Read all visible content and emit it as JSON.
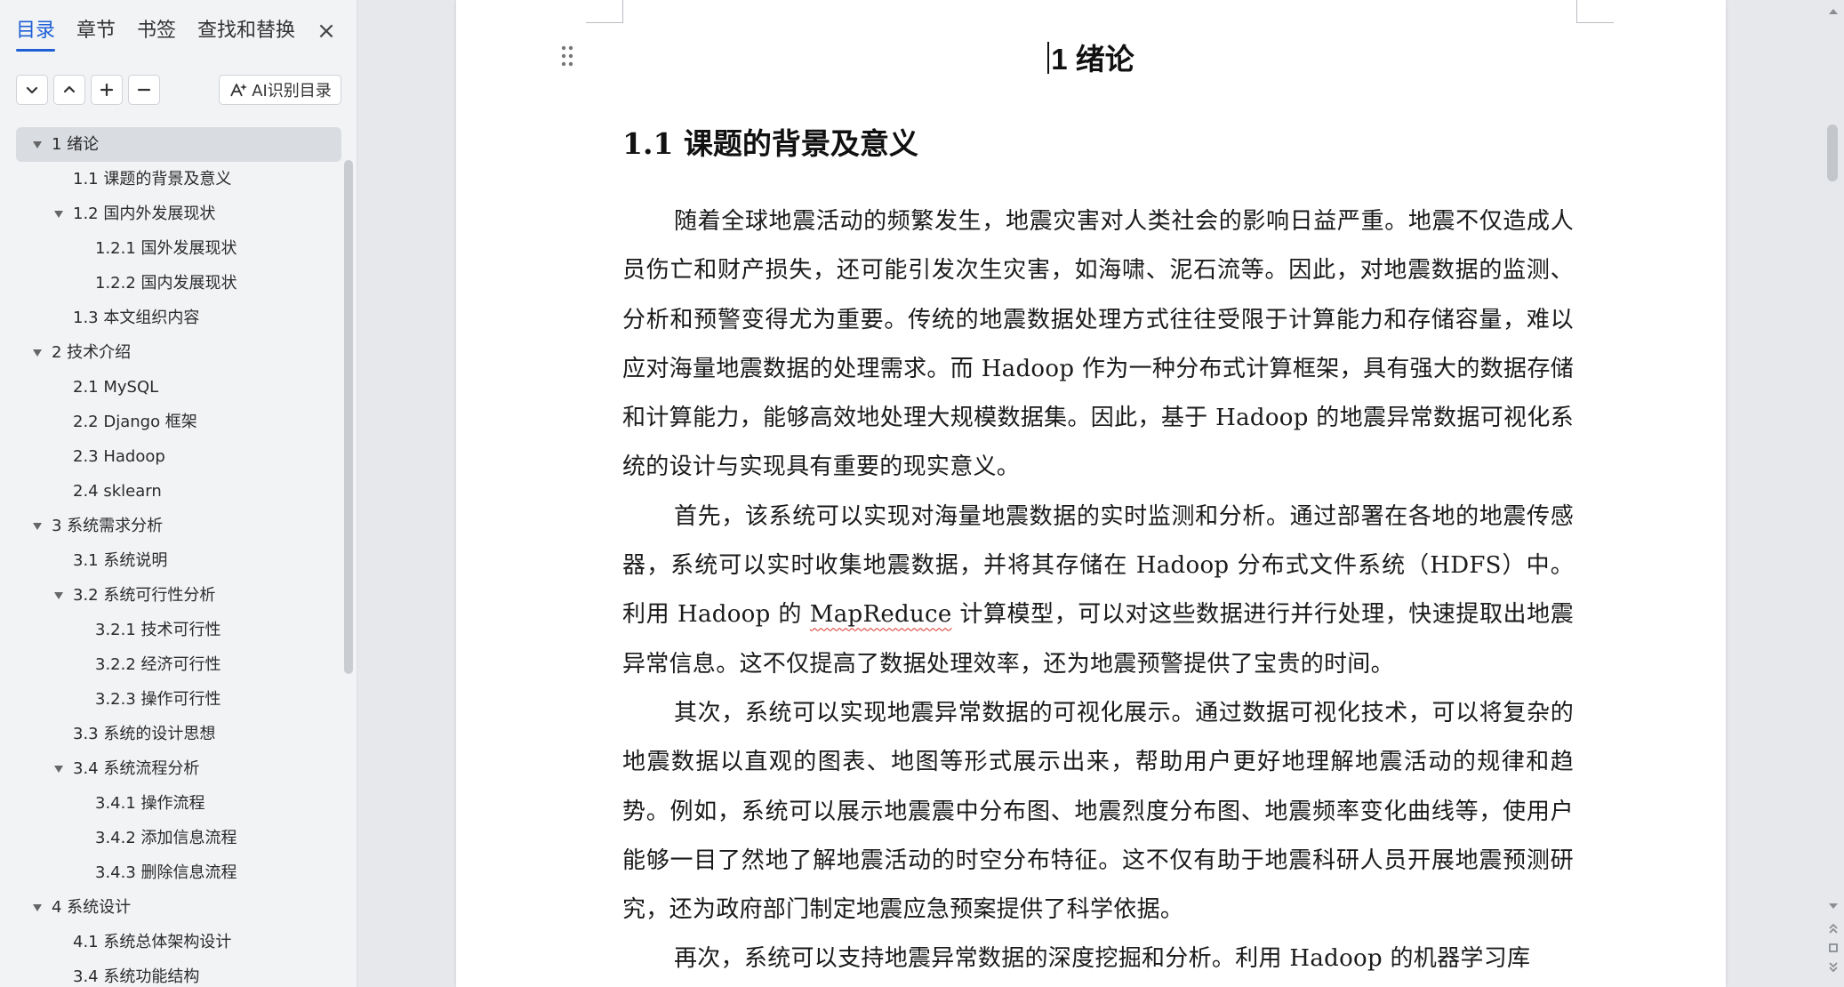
{
  "sidebar": {
    "tabs": [
      "目录",
      "章节",
      "书签",
      "查找和替换"
    ],
    "close_symbol": "×",
    "toolbar_icons": [
      "chevron-down-icon",
      "chevron-up-icon",
      "plus-icon",
      "minus-icon"
    ],
    "ai_button_label": "AI识别目录",
    "toc": [
      {
        "label": "1  绪论",
        "level": 1,
        "expanded": true,
        "selected": true
      },
      {
        "label": "1.1  课题的背景及意义",
        "level": 2,
        "expanded": null
      },
      {
        "label": "1.2  国内外发展现状",
        "level": 2,
        "expanded": true
      },
      {
        "label": "1.2.1  国外发展现状",
        "level": 3,
        "expanded": null
      },
      {
        "label": "1.2.2  国内发展现状",
        "level": 3,
        "expanded": null
      },
      {
        "label": "1.3  本文组织内容",
        "level": 2,
        "expanded": null
      },
      {
        "label": "2  技术介绍",
        "level": 1,
        "expanded": true
      },
      {
        "label": "2.1 MySQL",
        "level": 2,
        "expanded": null
      },
      {
        "label": "2.2 Django 框架",
        "level": 2,
        "expanded": null
      },
      {
        "label": "2.3 Hadoop",
        "level": 2,
        "expanded": null
      },
      {
        "label": "2.4 sklearn",
        "level": 2,
        "expanded": null
      },
      {
        "label": "3 系统需求分析",
        "level": 1,
        "expanded": true
      },
      {
        "label": "3.1 系统说明",
        "level": 2,
        "expanded": null
      },
      {
        "label": "3.2 系统可行性分析",
        "level": 2,
        "expanded": true
      },
      {
        "label": "3.2.1 技术可行性",
        "level": 3,
        "expanded": null
      },
      {
        "label": "3.2.2 经济可行性",
        "level": 3,
        "expanded": null
      },
      {
        "label": "3.2.3 操作可行性",
        "level": 3,
        "expanded": null
      },
      {
        "label": "3.3 系统的设计思想",
        "level": 2,
        "expanded": null
      },
      {
        "label": "3.4 系统流程分析",
        "level": 2,
        "expanded": true
      },
      {
        "label": "3.4.1 操作流程",
        "level": 3,
        "expanded": null
      },
      {
        "label": "3.4.2 添加信息流程",
        "level": 3,
        "expanded": null
      },
      {
        "label": "3.4.3 删除信息流程",
        "level": 3,
        "expanded": null
      },
      {
        "label": "4 系统设计",
        "level": 1,
        "expanded": true
      },
      {
        "label": "4.1  系统总体架构设计",
        "level": 2,
        "expanded": null
      },
      {
        "label": "3.4 系统功能结构",
        "level": 2,
        "expanded": null
      }
    ]
  },
  "document": {
    "chapter_title": "1  绪论",
    "section_title": "1.1  课题的背景及意义",
    "paragraphs": [
      {
        "before": "随着全球地震活动的频繁发生，地震灾害对人类社会的影响日益严重。地震不仅造成人员伤亡和财产损失，还可能引发次生灾害，如海啸、泥石流等。因此，对地震数据的监测、分析和预警变得尤为重要。传统的地震数据处理方式往往受限于计算能力和存储容量，难以应对海量地震数据的处理需求。而 Hadoop 作为一种分布式计算框架，具有强大的数据存储和计算能力，能够高效地处理大规模数据集。因此，基于 Hadoop 的地震异常数据可视化系统的设计与实现具有重要的现实意义。",
        "marked": "",
        "after": ""
      },
      {
        "before": "首先，该系统可以实现对海量地震数据的实时监测和分析。通过部署在各地的地震传感器，系统可以实时收集地震数据，并将其存储在 Hadoop 分布式文件系统（HDFS）中。利用 Hadoop 的 ",
        "marked": "MapReduce",
        "after": " 计算模型，可以对这些数据进行并行处理，快速提取出地震异常信息。这不仅提高了数据处理效率，还为地震预警提供了宝贵的时间。"
      },
      {
        "before": "其次，系统可以实现地震异常数据的可视化展示。通过数据可视化技术，可以将复杂的地震数据以直观的图表、地图等形式展示出来，帮助用户更好地理解地震活动的规律和趋势。例如，系统可以展示地震震中分布图、地震烈度分布图、地震频率变化曲线等，使用户能够一目了然地了解地震活动的时空分布特征。这不仅有助于地震科研人员开展地震预测研究，还为政府部门制定地震应急预案提供了科学依据。",
        "marked": "",
        "after": ""
      },
      {
        "before": "再次，系统可以支持地震异常数据的深度挖掘和分析。利用 Hadoop 的机器学习库",
        "marked": "",
        "after": ""
      }
    ]
  },
  "scrollbar": {
    "nav_icons": [
      "scroll-up-arrow-icon",
      "scroll-down-arrow-icon",
      "previous-page-icon",
      "select-browse-object-icon",
      "next-page-icon"
    ]
  }
}
